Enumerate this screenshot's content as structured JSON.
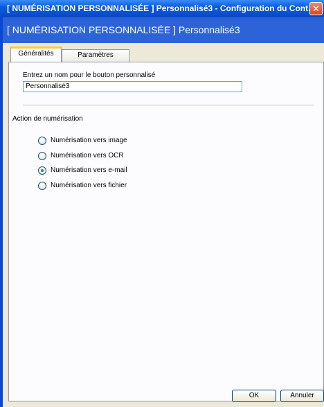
{
  "window": {
    "title": "[ NUMÉRISATION PERSONNALISÉE ]  Personnalisé3 - Configuration du Cont...",
    "close_glyph": "✕"
  },
  "header": {
    "title": "[ NUMÉRISATION PERSONNALISÉE ]  Personnalisé3"
  },
  "tabs": [
    {
      "label": "Généralités",
      "active": true
    },
    {
      "label": "Paramètres",
      "active": false
    }
  ],
  "general": {
    "name_label": "Entrez un nom pour le bouton personnalisé",
    "name_value": "Personnalisé3",
    "action_label": "Action de numérisation",
    "actions": [
      {
        "label": "Numérisation vers image",
        "selected": false
      },
      {
        "label": "Numérisation vers OCR",
        "selected": false
      },
      {
        "label": "Numérisation vers e-mail",
        "selected": true
      },
      {
        "label": "Numérisation vers fichier",
        "selected": false
      }
    ]
  },
  "buttons": {
    "ok": "OK",
    "cancel": "Annuler"
  }
}
